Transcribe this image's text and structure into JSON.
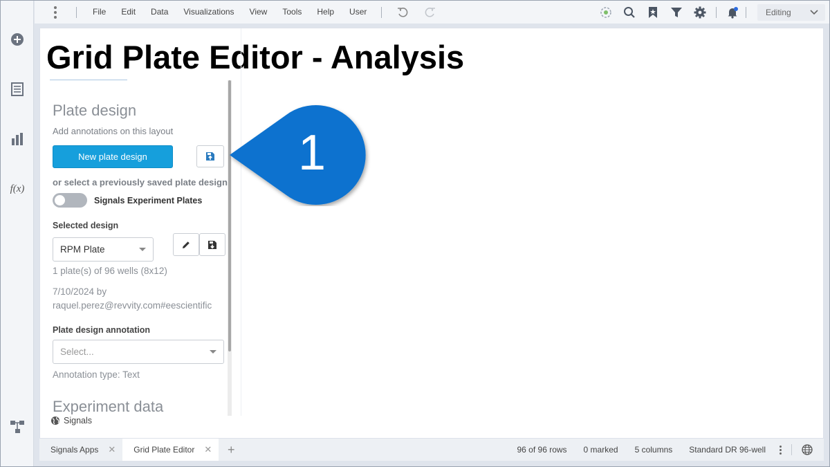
{
  "menubar": {
    "items": [
      "File",
      "Edit",
      "Data",
      "Visualizations",
      "View",
      "Tools",
      "Help",
      "User"
    ],
    "mode": "Editing"
  },
  "rail": {
    "icons": [
      "add-icon",
      "document-icon",
      "bar-chart-icon",
      "function-icon",
      "data-canvas-icon"
    ],
    "fx_label": "f(x)"
  },
  "page": {
    "title": "Grid Plate Editor - Analysis"
  },
  "panel": {
    "heading": "Plate design",
    "subheading": "Add annotations on this layout",
    "new_button": "New plate design",
    "or_select": "or select a previously saved plate design",
    "toggle_label": "Signals Experiment Plates",
    "toggle_on": false,
    "selected_design_label": "Selected design",
    "selected_design": "RPM Plate",
    "plates_info": "1 plate(s) of 96 wells (8x12)",
    "date_by": "7/10/2024 by",
    "author": "raquel.perez@revvity.com#eescientific",
    "annotation_label": "Plate design annotation",
    "annotation_placeholder": "Select...",
    "annotation_type": "Annotation type: Text",
    "experiment_heading": "Experiment data",
    "signals_label": "Signals"
  },
  "callout": {
    "number": "1",
    "color": "#0a72cf"
  },
  "bottom": {
    "tabs": [
      {
        "label": "Signals Apps",
        "active": false
      },
      {
        "label": "Grid Plate Editor",
        "active": true
      }
    ],
    "add_tab": "+",
    "status": {
      "rows": "96 of 96 rows",
      "marked": "0 marked",
      "columns": "5 columns",
      "table": "Standard DR 96-well"
    }
  }
}
